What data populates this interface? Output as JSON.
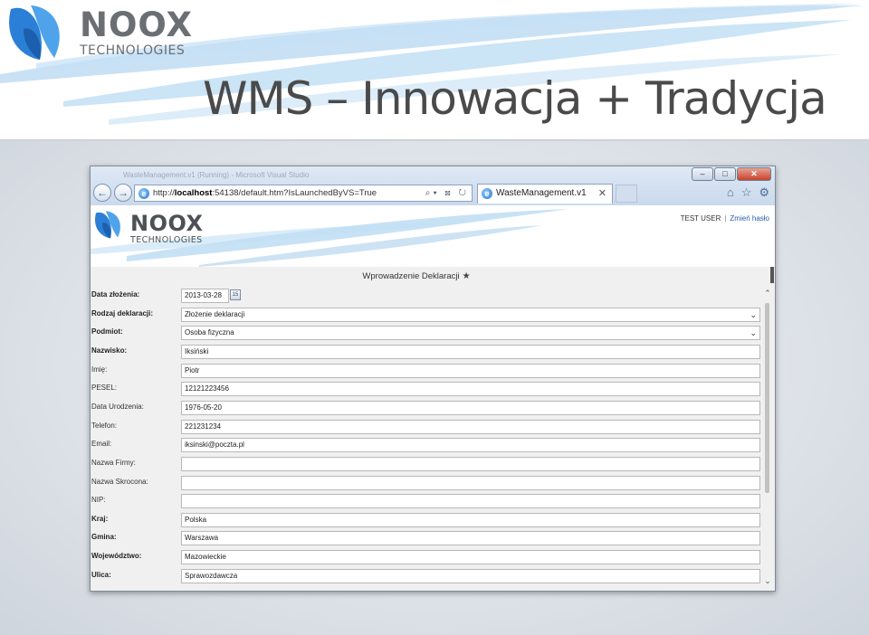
{
  "slide": {
    "logo_big": "NOOX",
    "logo_small": "TECHNOLOGIES",
    "title": "WMS – Innowacja + Tradycja"
  },
  "browser": {
    "window_title": "WasteManagement.v1 (Running) - Microsoft Visual Studio",
    "win_minimize": "–",
    "win_maximize": "□",
    "win_close": "✕",
    "back_icon": "←",
    "forward_icon": "→",
    "address_prefix": "http://",
    "address_host": "localhost",
    "address_rest": ":54138/default.htm?IsLaunchedByVS=True",
    "address_actions": "⌕▾ ⊠ ↻",
    "tab_label": "WasteManagement.v1",
    "tab_close": "✕",
    "home_icon": "⌂",
    "favorites_icon": "☆",
    "tools_icon": "⚙"
  },
  "app": {
    "logo_big": "NOOX",
    "logo_small": "TECHNOLOGIES",
    "user_name": "TEST USER",
    "user_sep": "|",
    "change_password": "Zmień hasło"
  },
  "form": {
    "title": "Wprowadzenie Deklaracji",
    "title_icon": "★",
    "calendar_icon": "15",
    "fields": [
      {
        "label": "Data złożenia:",
        "value": "2013-03-28"
      },
      {
        "label": "Rodzaj deklaracji:",
        "value": "Złożenie deklaracji"
      },
      {
        "label": "Podmiot:",
        "value": "Osoba fizyczna"
      },
      {
        "label": "Nazwisko:",
        "value": "Iksiński"
      },
      {
        "label": "Imię:",
        "value": "Piotr"
      },
      {
        "label": "PESEL:",
        "value": "12121223456"
      },
      {
        "label": "Data Urodzenia:",
        "value": "1976-05-20"
      },
      {
        "label": "Telefon:",
        "value": "221231234"
      },
      {
        "label": "Email:",
        "value": "iksinski@poczta.pl"
      },
      {
        "label": "Nazwa Firmy:",
        "value": ""
      },
      {
        "label": "Nazwa Skrocona:",
        "value": ""
      },
      {
        "label": "NIP:",
        "value": ""
      },
      {
        "label": "Kraj:",
        "value": "Polska"
      },
      {
        "label": "Gmina:",
        "value": "Warszawa"
      },
      {
        "label": "Województwo:",
        "value": "Mazowieckie"
      },
      {
        "label": "Ulica:",
        "value": "Sprawozdawcza"
      }
    ],
    "chevron_icon": "⌄",
    "scroll_up": "⌃",
    "scroll_down": "⌄"
  },
  "colors": {
    "brand_blue": "#2b7fd6",
    "brand_gray": "#6b6e73",
    "link_blue": "#2a5aa8"
  }
}
